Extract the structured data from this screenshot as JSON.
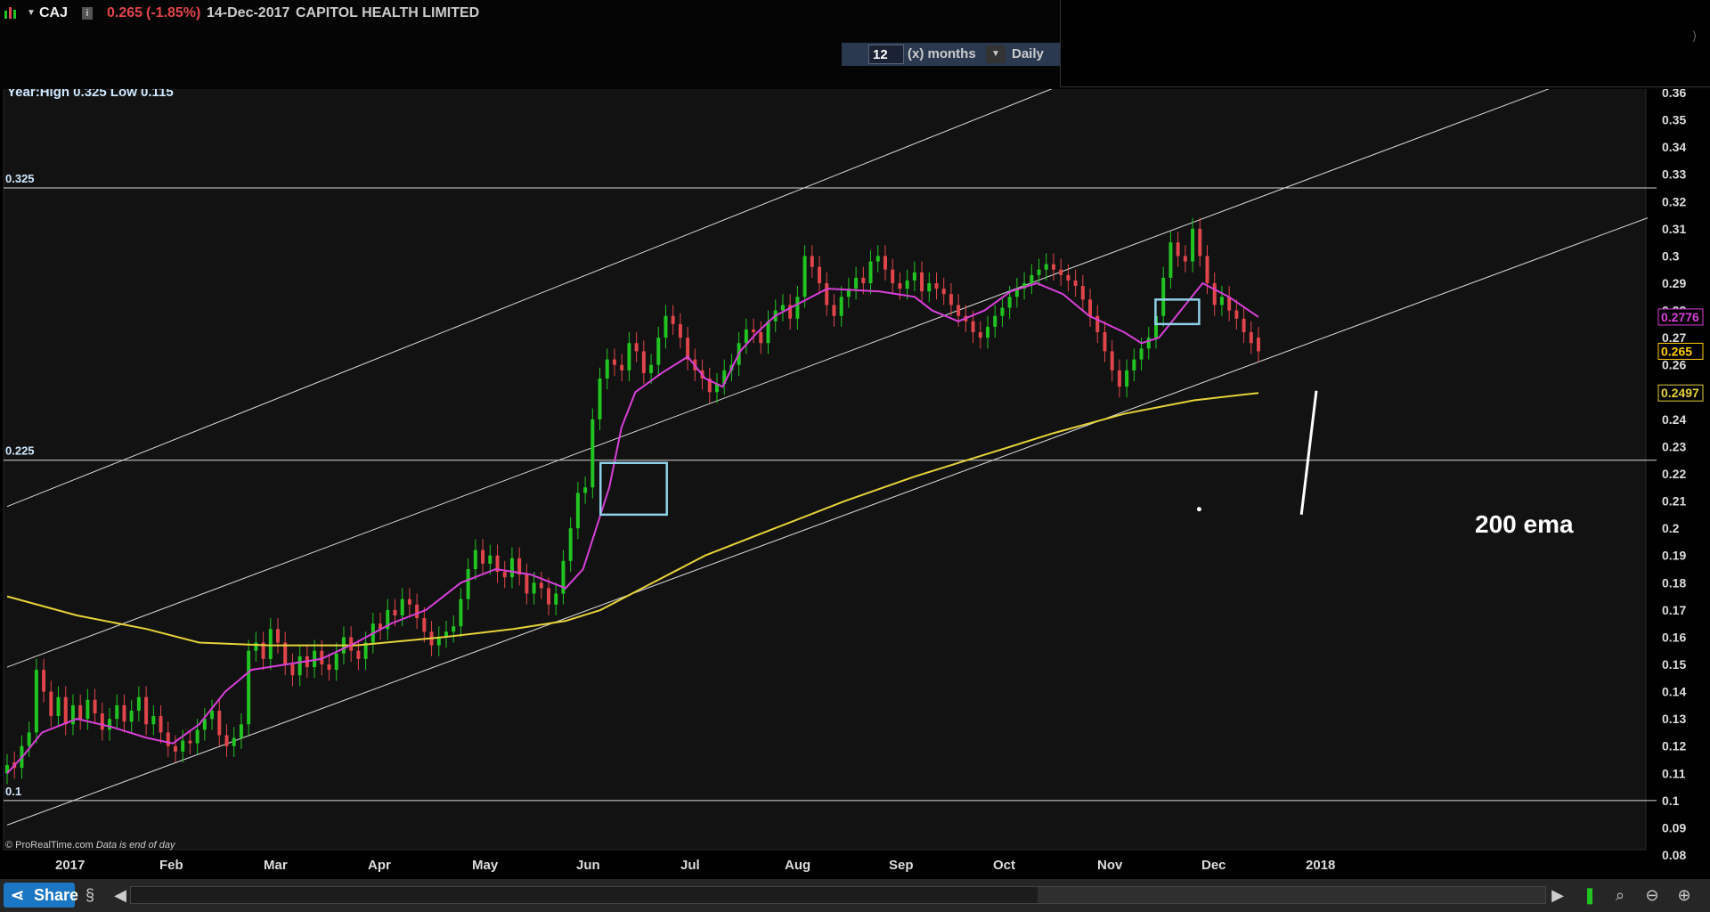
{
  "header": {
    "symbol": "CAJ",
    "price": "0.265",
    "change": "(-1.85%)",
    "date": "14-Dec-2017",
    "company": "CAPITOL HEALTH LIMITED",
    "period_value": "12",
    "period_unit": "(x) months",
    "interval": "Daily"
  },
  "chart_info": {
    "year_range": "Year:High 0.325 Low 0.115",
    "copyright": "© ProRealTime.com",
    "note": "Data is end of day"
  },
  "annotation": "200 ema",
  "footer": {
    "share_label": "Share"
  },
  "colors": {
    "up": "#21c421",
    "down": "#e0454b",
    "ema_short": "#d840d8",
    "ema_long": "#e6d23a",
    "box": "#8ed0e8",
    "line": "#d8d8d8"
  },
  "chart_data": {
    "type": "candlestick",
    "ylim": [
      0.08,
      0.36
    ],
    "y_ticks": [
      0.36,
      0.35,
      0.34,
      0.33,
      0.32,
      0.31,
      0.3,
      0.29,
      0.28,
      0.27,
      0.26,
      0.25,
      0.24,
      0.23,
      0.22,
      0.21,
      0.2,
      0.19,
      0.18,
      0.17,
      0.16,
      0.15,
      0.14,
      0.13,
      0.12,
      0.11,
      0.1,
      0.09,
      0.08
    ],
    "x_labels": [
      "2017",
      "Feb",
      "Mar",
      "Apr",
      "May",
      "Jun",
      "Jul",
      "Aug",
      "Sep",
      "Oct",
      "Nov",
      "Dec",
      "2018"
    ],
    "y_badges": [
      {
        "label": "0.2776",
        "value": 0.2776,
        "color": "#d840d8"
      },
      {
        "label": "0.265",
        "value": 0.265,
        "color": "#ffcc00"
      },
      {
        "label": "0.2497",
        "value": 0.2497,
        "color": "#e6d23a"
      }
    ],
    "horizontal_levels": [
      {
        "label": "0.325",
        "value": 0.325
      },
      {
        "label": "0.225",
        "value": 0.225
      },
      {
        "label": "0.1",
        "value": 0.1
      }
    ],
    "ema_short": [
      [
        0,
        0.11
      ],
      [
        10,
        0.117
      ],
      [
        20,
        0.125
      ],
      [
        40,
        0.13
      ],
      [
        60,
        0.127
      ],
      [
        80,
        0.123
      ],
      [
        95,
        0.121
      ],
      [
        110,
        0.128
      ],
      [
        125,
        0.14
      ],
      [
        140,
        0.148
      ],
      [
        160,
        0.15
      ],
      [
        180,
        0.152
      ],
      [
        200,
        0.158
      ],
      [
        220,
        0.165
      ],
      [
        240,
        0.17
      ],
      [
        260,
        0.18
      ],
      [
        280,
        0.185
      ],
      [
        300,
        0.183
      ],
      [
        320,
        0.178
      ],
      [
        330,
        0.185
      ],
      [
        340,
        0.205
      ],
      [
        345,
        0.215
      ],
      [
        352,
        0.237
      ],
      [
        360,
        0.25
      ],
      [
        375,
        0.257
      ],
      [
        390,
        0.263
      ],
      [
        400,
        0.255
      ],
      [
        410,
        0.252
      ],
      [
        420,
        0.265
      ],
      [
        430,
        0.272
      ],
      [
        440,
        0.278
      ],
      [
        455,
        0.283
      ],
      [
        470,
        0.288
      ],
      [
        500,
        0.287
      ],
      [
        520,
        0.285
      ],
      [
        530,
        0.28
      ],
      [
        545,
        0.276
      ],
      [
        560,
        0.28
      ],
      [
        575,
        0.287
      ],
      [
        590,
        0.29
      ],
      [
        605,
        0.286
      ],
      [
        620,
        0.278
      ],
      [
        640,
        0.272
      ],
      [
        650,
        0.268
      ],
      [
        660,
        0.27
      ],
      [
        670,
        0.278
      ],
      [
        685,
        0.29
      ],
      [
        700,
        0.285
      ],
      [
        717,
        0.2776
      ]
    ],
    "ema_long": [
      [
        0,
        0.175
      ],
      [
        40,
        0.168
      ],
      [
        80,
        0.163
      ],
      [
        110,
        0.158
      ],
      [
        150,
        0.157
      ],
      [
        200,
        0.157
      ],
      [
        250,
        0.16
      ],
      [
        290,
        0.163
      ],
      [
        320,
        0.166
      ],
      [
        340,
        0.17
      ],
      [
        370,
        0.18
      ],
      [
        400,
        0.19
      ],
      [
        440,
        0.2
      ],
      [
        480,
        0.21
      ],
      [
        520,
        0.219
      ],
      [
        560,
        0.227
      ],
      [
        600,
        0.235
      ],
      [
        640,
        0.242
      ],
      [
        680,
        0.247
      ],
      [
        717,
        0.2497
      ]
    ],
    "channels": [
      {
        "from": [
          0,
          0.208
        ],
        "to": [
          640,
          0.372
        ]
      },
      {
        "from": [
          0,
          0.149
        ],
        "to": [
          940,
          0.375
        ]
      },
      {
        "from": [
          0,
          0.091
        ],
        "to": [
          940,
          0.314
        ]
      }
    ],
    "boxes": [
      {
        "x0": 340,
        "x1": 378,
        "y0": 0.205,
        "y1": 0.224
      },
      {
        "x0": 658,
        "x1": 683,
        "y0": 0.275,
        "y1": 0.284
      }
    ],
    "arrow": {
      "from": [
        762,
        0.247
      ],
      "to": [
        742,
        0.2505
      ]
    },
    "dot": [
      683,
      0.207
    ],
    "candles": {
      "closes": [
        0.113,
        0.112,
        0.12,
        0.125,
        0.148,
        0.14,
        0.131,
        0.138,
        0.128,
        0.135,
        0.13,
        0.137,
        0.132,
        0.126,
        0.13,
        0.135,
        0.129,
        0.133,
        0.138,
        0.128,
        0.131,
        0.125,
        0.12,
        0.118,
        0.122,
        0.121,
        0.126,
        0.13,
        0.133,
        0.124,
        0.12,
        0.123,
        0.128,
        0.155,
        0.158,
        0.152,
        0.163,
        0.158,
        0.15,
        0.146,
        0.153,
        0.149,
        0.155,
        0.15,
        0.148,
        0.154,
        0.16,
        0.155,
        0.152,
        0.158,
        0.165,
        0.163,
        0.17,
        0.168,
        0.174,
        0.172,
        0.167,
        0.162,
        0.157,
        0.16,
        0.162,
        0.164,
        0.174,
        0.185,
        0.192,
        0.187,
        0.19,
        0.184,
        0.182,
        0.189,
        0.183,
        0.176,
        0.18,
        0.178,
        0.172,
        0.176,
        0.188,
        0.2,
        0.213,
        0.215,
        0.24,
        0.255,
        0.262,
        0.26,
        0.258,
        0.268,
        0.265,
        0.257,
        0.26,
        0.27,
        0.278,
        0.275,
        0.27,
        0.262,
        0.258,
        0.255,
        0.25,
        0.253,
        0.258,
        0.26,
        0.268,
        0.273,
        0.272,
        0.268,
        0.276,
        0.28,
        0.282,
        0.277,
        0.285,
        0.3,
        0.296,
        0.29,
        0.282,
        0.278,
        0.285,
        0.288,
        0.292,
        0.29,
        0.298,
        0.3,
        0.295,
        0.29,
        0.288,
        0.291,
        0.294,
        0.287,
        0.29,
        0.288,
        0.286,
        0.282,
        0.278,
        0.276,
        0.272,
        0.27,
        0.274,
        0.278,
        0.281,
        0.285,
        0.288,
        0.29,
        0.293,
        0.295,
        0.297,
        0.295,
        0.293,
        0.291,
        0.289,
        0.284,
        0.278,
        0.272,
        0.265,
        0.258,
        0.252,
        0.258,
        0.262,
        0.266,
        0.27,
        0.278,
        0.292,
        0.305,
        0.3,
        0.298,
        0.31,
        0.3,
        0.29,
        0.282,
        0.285,
        0.28,
        0.277,
        0.272,
        0.268,
        0.265
      ],
      "opens": [
        0.11,
        0.114,
        0.112,
        0.12,
        0.125,
        0.148,
        0.14,
        0.131,
        0.138,
        0.128,
        0.135,
        0.13,
        0.137,
        0.132,
        0.126,
        0.13,
        0.135,
        0.129,
        0.133,
        0.138,
        0.128,
        0.131,
        0.125,
        0.12,
        0.118,
        0.122,
        0.121,
        0.126,
        0.13,
        0.133,
        0.124,
        0.12,
        0.123,
        0.128,
        0.155,
        0.158,
        0.152,
        0.163,
        0.158,
        0.15,
        0.146,
        0.153,
        0.149,
        0.155,
        0.15,
        0.148,
        0.154,
        0.16,
        0.155,
        0.152,
        0.158,
        0.165,
        0.163,
        0.17,
        0.168,
        0.174,
        0.172,
        0.167,
        0.162,
        0.157,
        0.16,
        0.162,
        0.164,
        0.174,
        0.185,
        0.192,
        0.187,
        0.19,
        0.184,
        0.182,
        0.189,
        0.183,
        0.176,
        0.18,
        0.178,
        0.172,
        0.176,
        0.188,
        0.2,
        0.213,
        0.215,
        0.24,
        0.255,
        0.262,
        0.26,
        0.258,
        0.268,
        0.265,
        0.257,
        0.26,
        0.27,
        0.278,
        0.275,
        0.27,
        0.262,
        0.258,
        0.255,
        0.25,
        0.253,
        0.258,
        0.26,
        0.268,
        0.273,
        0.272,
        0.268,
        0.276,
        0.28,
        0.282,
        0.277,
        0.285,
        0.3,
        0.296,
        0.29,
        0.282,
        0.278,
        0.285,
        0.288,
        0.292,
        0.29,
        0.298,
        0.3,
        0.295,
        0.29,
        0.288,
        0.291,
        0.294,
        0.287,
        0.29,
        0.288,
        0.286,
        0.282,
        0.278,
        0.276,
        0.272,
        0.27,
        0.274,
        0.278,
        0.281,
        0.285,
        0.288,
        0.29,
        0.293,
        0.295,
        0.297,
        0.295,
        0.293,
        0.291,
        0.289,
        0.284,
        0.278,
        0.272,
        0.265,
        0.258,
        0.252,
        0.258,
        0.262,
        0.266,
        0.27,
        0.278,
        0.292,
        0.305,
        0.3,
        0.298,
        0.31,
        0.3,
        0.29,
        0.282,
        0.285,
        0.28,
        0.277,
        0.272,
        0.27
      ]
    }
  }
}
